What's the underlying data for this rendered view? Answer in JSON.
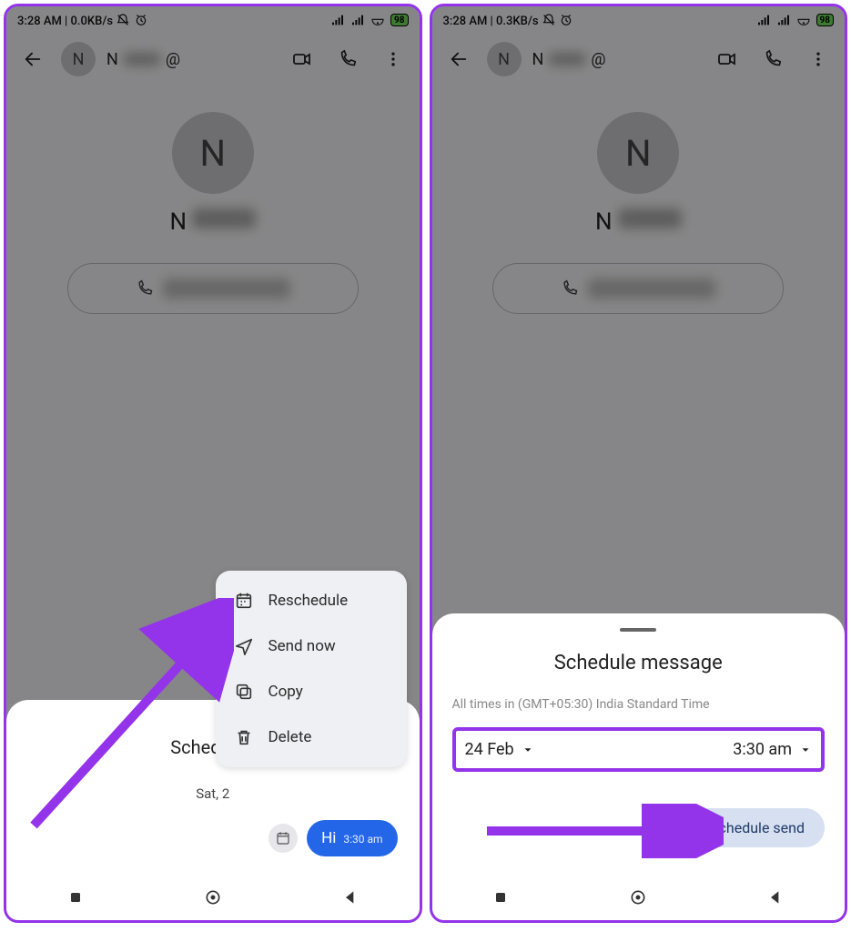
{
  "status": {
    "left_time": "3:28 AM",
    "left_net_a": "0.0KB/s",
    "left_net_b": "0.3KB/s",
    "battery": "98"
  },
  "contact": {
    "initial": "N",
    "name_prefix": "N",
    "at": "@"
  },
  "ctx_menu": {
    "reschedule": "Reschedule",
    "send_now": "Send now",
    "copy": "Copy",
    "delete": "Delete"
  },
  "scheduled_sheet": {
    "title_partial": "Scheduled",
    "date_partial": "Sat, 2",
    "msg_text": "Hi",
    "msg_time": "3:30 am"
  },
  "sched_sheet": {
    "title": "Schedule message",
    "tz_note": "All times in (GMT+05:30) India Standard Time",
    "date": "24 Feb",
    "time": "3:30 am",
    "button": "Schedule send"
  }
}
